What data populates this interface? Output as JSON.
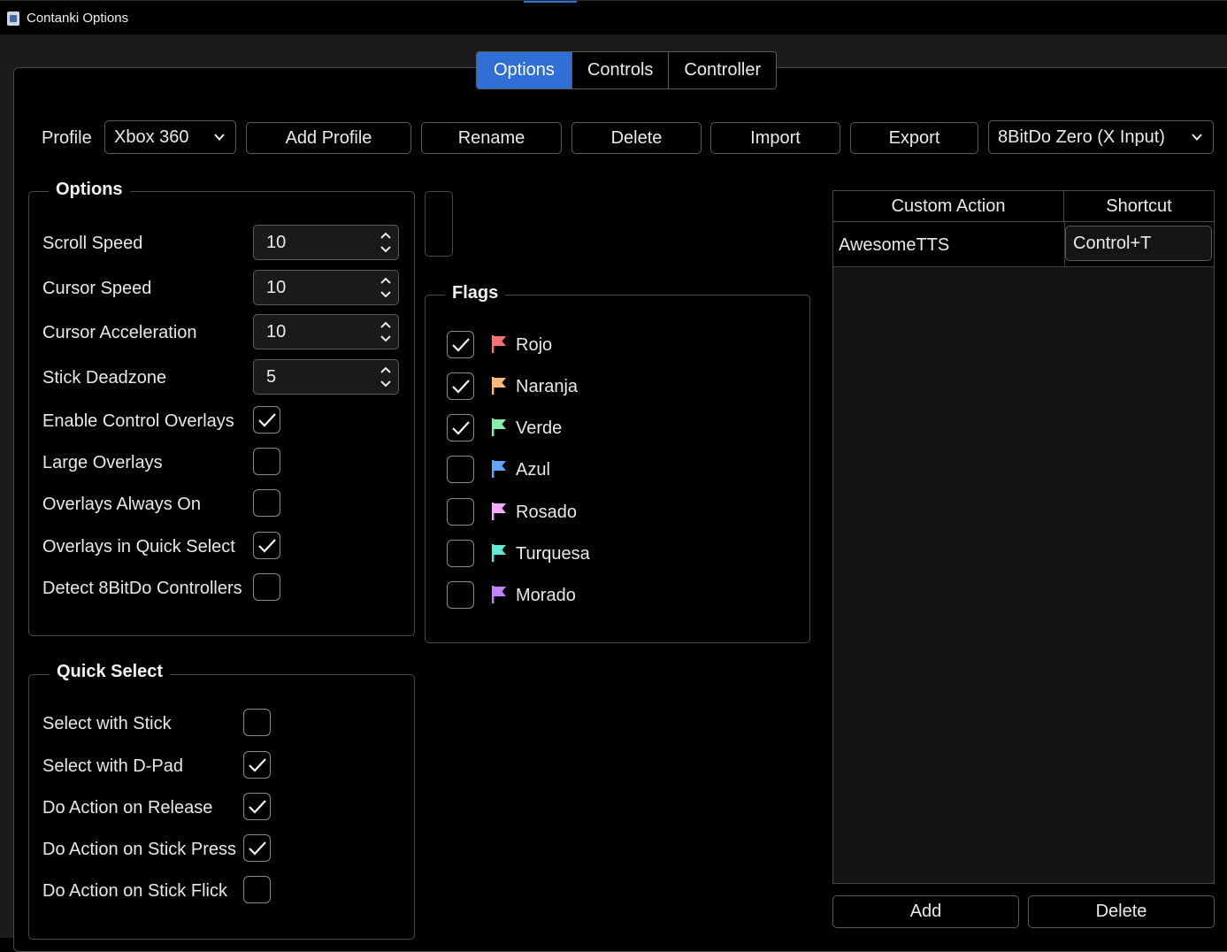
{
  "window": {
    "title": "Contanki Options"
  },
  "tabs": [
    "Options",
    "Controls",
    "Controller"
  ],
  "toolbar": {
    "profile_label": "Profile",
    "profile_value": "Xbox 360",
    "add_profile": "Add Profile",
    "rename": "Rename",
    "delete": "Delete",
    "import": "Import",
    "export": "Export",
    "controller_value": "8BitDo Zero (X Input)"
  },
  "options_group": {
    "title": "Options",
    "spinners": [
      {
        "label": "Scroll Speed",
        "value": "10"
      },
      {
        "label": "Cursor Speed",
        "value": "10"
      },
      {
        "label": "Cursor Acceleration",
        "value": "10"
      },
      {
        "label": "Stick Deadzone",
        "value": "5"
      }
    ],
    "checks": [
      {
        "label": "Enable Control Overlays",
        "checked": true
      },
      {
        "label": "Large Overlays",
        "checked": false
      },
      {
        "label": "Overlays Always On",
        "checked": false
      },
      {
        "label": "Overlays in Quick Select",
        "checked": true
      },
      {
        "label": "Detect 8BitDo Controllers",
        "checked": false
      }
    ]
  },
  "quick_select": {
    "title": "Quick Select",
    "checks": [
      {
        "label": "Select with Stick",
        "checked": false
      },
      {
        "label": "Select with D-Pad",
        "checked": true
      },
      {
        "label": "Do Action on Release",
        "checked": true
      },
      {
        "label": "Do Action on Stick Press",
        "checked": true
      },
      {
        "label": "Do Action on Stick Flick",
        "checked": false
      }
    ]
  },
  "flags": {
    "title": "Flags",
    "items": [
      {
        "label": "Rojo",
        "checked": true,
        "color": "#f87171"
      },
      {
        "label": "Naranja",
        "checked": true,
        "color": "#fdba74"
      },
      {
        "label": "Verde",
        "checked": true,
        "color": "#86efac"
      },
      {
        "label": "Azul",
        "checked": false,
        "color": "#60a5fa"
      },
      {
        "label": "Rosado",
        "checked": false,
        "color": "#f0abfc"
      },
      {
        "label": "Turquesa",
        "checked": false,
        "color": "#5eead4"
      },
      {
        "label": "Morado",
        "checked": false,
        "color": "#c084fc"
      }
    ]
  },
  "custom_actions": {
    "headers": [
      "Custom Action",
      "Shortcut"
    ],
    "rows": [
      {
        "action": "AwesomeTTS",
        "shortcut": "Control+T"
      }
    ],
    "add": "Add",
    "delete": "Delete"
  }
}
